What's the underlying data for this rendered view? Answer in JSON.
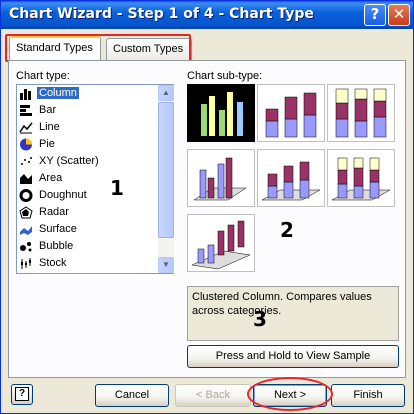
{
  "window": {
    "title": "Chart Wizard - Step 1 of 4 - Chart Type",
    "help_glyph": "?",
    "close_glyph": "✕"
  },
  "tabs": [
    {
      "label": "Standard Types",
      "active": true
    },
    {
      "label": "Custom Types",
      "active": false
    }
  ],
  "chart_type": {
    "label": "Chart type:",
    "items": [
      {
        "label": "Column",
        "icon": "column-chart-icon",
        "selected": true
      },
      {
        "label": "Bar",
        "icon": "bar-chart-icon"
      },
      {
        "label": "Line",
        "icon": "line-chart-icon"
      },
      {
        "label": "Pie",
        "icon": "pie-chart-icon"
      },
      {
        "label": "XY (Scatter)",
        "icon": "scatter-chart-icon"
      },
      {
        "label": "Area",
        "icon": "area-chart-icon"
      },
      {
        "label": "Doughnut",
        "icon": "doughnut-chart-icon"
      },
      {
        "label": "Radar",
        "icon": "radar-chart-icon"
      },
      {
        "label": "Surface",
        "icon": "surface-chart-icon"
      },
      {
        "label": "Bubble",
        "icon": "bubble-chart-icon"
      },
      {
        "label": "Stock",
        "icon": "stock-chart-icon"
      }
    ]
  },
  "subtype": {
    "label": "Chart sub-type:",
    "items": [
      {
        "icon": "clustered-column-icon",
        "selected": true
      },
      {
        "icon": "stacked-column-icon"
      },
      {
        "icon": "100-percent-stacked-column-icon"
      },
      {
        "icon": "3d-clustered-column-icon"
      },
      {
        "icon": "3d-stacked-column-icon"
      },
      {
        "icon": "3d-100-percent-stacked-column-icon"
      },
      {
        "icon": "3d-column-icon"
      }
    ],
    "description": "Clustered Column. Compares values across categories."
  },
  "annotations": {
    "one": "1",
    "two": "2",
    "three": "3"
  },
  "buttons": {
    "sample": "Press and Hold to View Sample",
    "cancel": "Cancel",
    "back": "< Back",
    "next": "Next >",
    "finish": "Finish"
  },
  "colors": {
    "bar_blue": "#9999ff",
    "bar_maroon": "#993366",
    "bar_cream": "#ffffcc",
    "selected_blue": "#316ac5",
    "highlight_red": "#e8262a"
  }
}
